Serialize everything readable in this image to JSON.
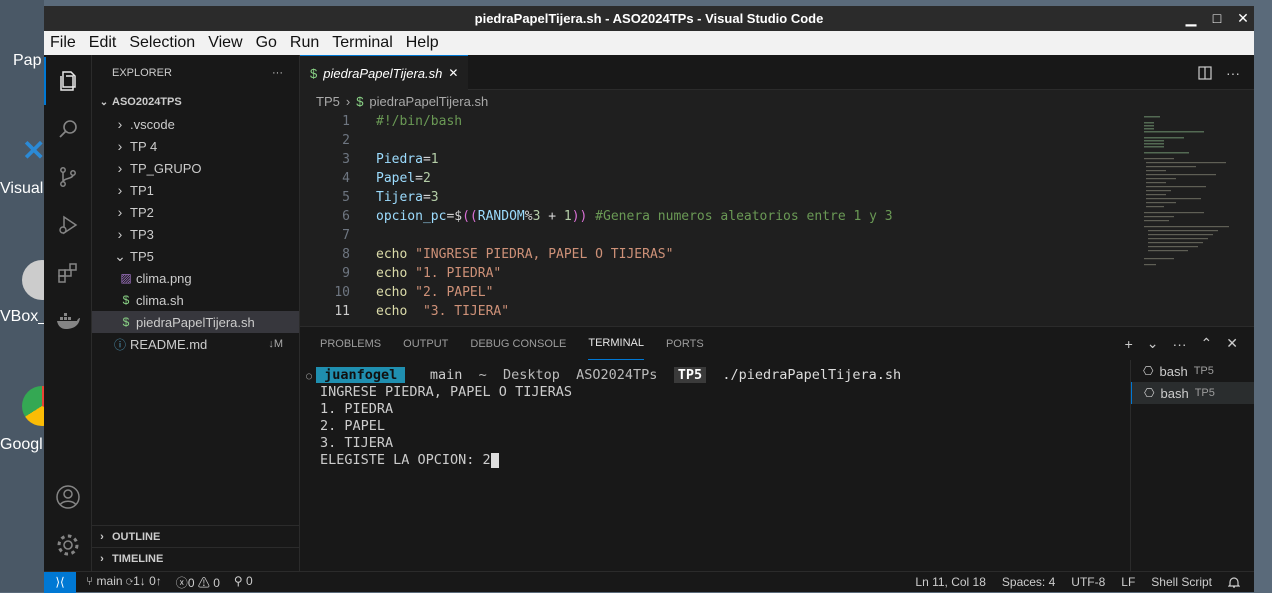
{
  "desktop": {
    "labels": [
      "Pap",
      "Visual",
      "VBox_",
      "Googl"
    ]
  },
  "window": {
    "title": "piedraPapelTijera.sh - ASO2024TPs - Visual Studio Code",
    "min": "▁",
    "max": "□",
    "close": "✕"
  },
  "menu": [
    "File",
    "Edit",
    "Selection",
    "View",
    "Go",
    "Run",
    "Terminal",
    "Help"
  ],
  "activity_icons": [
    "explorer-icon",
    "search-icon",
    "source-control-icon",
    "run-debug-icon",
    "extensions-icon",
    "docker-icon",
    "accounts-icon",
    "settings-icon"
  ],
  "sidebar": {
    "title": "EXPLORER",
    "more": "···",
    "root": "ASO2024TPS",
    "items": [
      {
        "label": ".vscode",
        "indent": 1,
        "kind": "folder",
        "open": false
      },
      {
        "label": "TP 4",
        "indent": 1,
        "kind": "folder",
        "open": false
      },
      {
        "label": "TP_GRUPO",
        "indent": 1,
        "kind": "folder",
        "open": false
      },
      {
        "label": "TP1",
        "indent": 1,
        "kind": "folder",
        "open": false
      },
      {
        "label": "TP2",
        "indent": 1,
        "kind": "folder",
        "open": false
      },
      {
        "label": "TP3",
        "indent": 1,
        "kind": "folder",
        "open": false
      },
      {
        "label": "TP5",
        "indent": 1,
        "kind": "folder",
        "open": true
      },
      {
        "label": "clima.png",
        "indent": 2,
        "kind": "image"
      },
      {
        "label": "clima.sh",
        "indent": 2,
        "kind": "shell"
      },
      {
        "label": "piedraPapelTijera.sh",
        "indent": 2,
        "kind": "shell",
        "selected": true
      },
      {
        "label": "README.md",
        "indent": 1,
        "kind": "info",
        "badge": "↓M"
      }
    ],
    "outline": "OUTLINE",
    "timeline": "TIMELINE"
  },
  "editor": {
    "tab_label": "piedraPapelTijera.sh",
    "tab_icon": "$",
    "tab_close": "✕",
    "breadcrumb": [
      "TP5",
      "piedraPapelTijera.sh"
    ],
    "lines": [
      {
        "n": "1",
        "tokens": [
          {
            "t": "#!/bin/bash",
            "c": "#6a9955"
          }
        ]
      },
      {
        "n": "2",
        "tokens": []
      },
      {
        "n": "3",
        "tokens": [
          {
            "t": "Piedra",
            "c": "#9cdcfe"
          },
          {
            "t": "=",
            "c": "#d4d4d4"
          },
          {
            "t": "1",
            "c": "#b5cea8"
          }
        ]
      },
      {
        "n": "4",
        "tokens": [
          {
            "t": "Papel",
            "c": "#9cdcfe"
          },
          {
            "t": "=",
            "c": "#d4d4d4"
          },
          {
            "t": "2",
            "c": "#b5cea8"
          }
        ]
      },
      {
        "n": "5",
        "tokens": [
          {
            "t": "Tijera",
            "c": "#9cdcfe"
          },
          {
            "t": "=",
            "c": "#d4d4d4"
          },
          {
            "t": "3",
            "c": "#b5cea8"
          }
        ]
      },
      {
        "n": "6",
        "tokens": [
          {
            "t": "opcion_pc",
            "c": "#9cdcfe"
          },
          {
            "t": "=$",
            "c": "#d4d4d4"
          },
          {
            "t": "((",
            "c": "#da70d6"
          },
          {
            "t": "RANDOM",
            "c": "#9cdcfe"
          },
          {
            "t": "%",
            "c": "#d4d4d4"
          },
          {
            "t": "3",
            "c": "#b5cea8"
          },
          {
            "t": " + ",
            "c": "#d4d4d4"
          },
          {
            "t": "1",
            "c": "#b5cea8"
          },
          {
            "t": "))",
            "c": "#da70d6"
          },
          {
            "t": " #Genera numeros aleatorios entre 1 y 3",
            "c": "#6a9955"
          }
        ]
      },
      {
        "n": "7",
        "tokens": []
      },
      {
        "n": "8",
        "tokens": [
          {
            "t": "echo",
            "c": "#dcdcaa"
          },
          {
            "t": " \"INGRESE PIEDRA, PAPEL O TIJERAS\"",
            "c": "#ce9178"
          }
        ]
      },
      {
        "n": "9",
        "tokens": [
          {
            "t": "echo",
            "c": "#dcdcaa"
          },
          {
            "t": " \"1. PIEDRA\"",
            "c": "#ce9178"
          }
        ]
      },
      {
        "n": "10",
        "tokens": [
          {
            "t": "echo",
            "c": "#dcdcaa"
          },
          {
            "t": " \"2. PAPEL\"",
            "c": "#ce9178"
          }
        ]
      },
      {
        "n": "11",
        "tokens": [
          {
            "t": "echo",
            "c": "#dcdcaa"
          },
          {
            "t": "  \"3. TIJERA\"",
            "c": "#ce9178"
          }
        ],
        "current": true
      }
    ]
  },
  "panel": {
    "tabs": [
      "PROBLEMS",
      "OUTPUT",
      "DEBUG CONSOLE",
      "TERMINAL",
      "PORTS"
    ],
    "active_tab": "TERMINAL",
    "actions": [
      "+",
      "⌄",
      "···",
      "⌃",
      "✕"
    ],
    "prompt": {
      "circle": "○",
      "user": " juanfogel ",
      "sep": "  ",
      "branch": " main ",
      "path": " ~  Desktop  ASO2024TPs  ",
      "dir": "TP5",
      "cmd": "  ./piedraPapelTijera.sh"
    },
    "output": [
      "INGRESE PIEDRA, PAPEL O TIJERAS",
      "1. PIEDRA",
      "2. PAPEL",
      "3. TIJERA",
      "ELEGISTE LA OPCION: 2"
    ],
    "terminals": [
      {
        "name": "bash",
        "cwd": "TP5",
        "selected": false
      },
      {
        "name": "bash",
        "cwd": "TP5",
        "selected": true
      }
    ]
  },
  "status": {
    "remote": "⟩⟨",
    "branch": "main",
    "sync": "1↓ 0↑",
    "errors": "0",
    "warnings": "0",
    "ports": "0",
    "position": "Ln 11, Col 18",
    "spaces": "Spaces: 4",
    "encoding": "UTF-8",
    "eol": "LF",
    "language": "Shell Script"
  },
  "colors": {
    "accent": "#0078d4",
    "prompt_user_bg": "#1f8fb0",
    "prompt_dir_bg": "#3a3a3a"
  }
}
